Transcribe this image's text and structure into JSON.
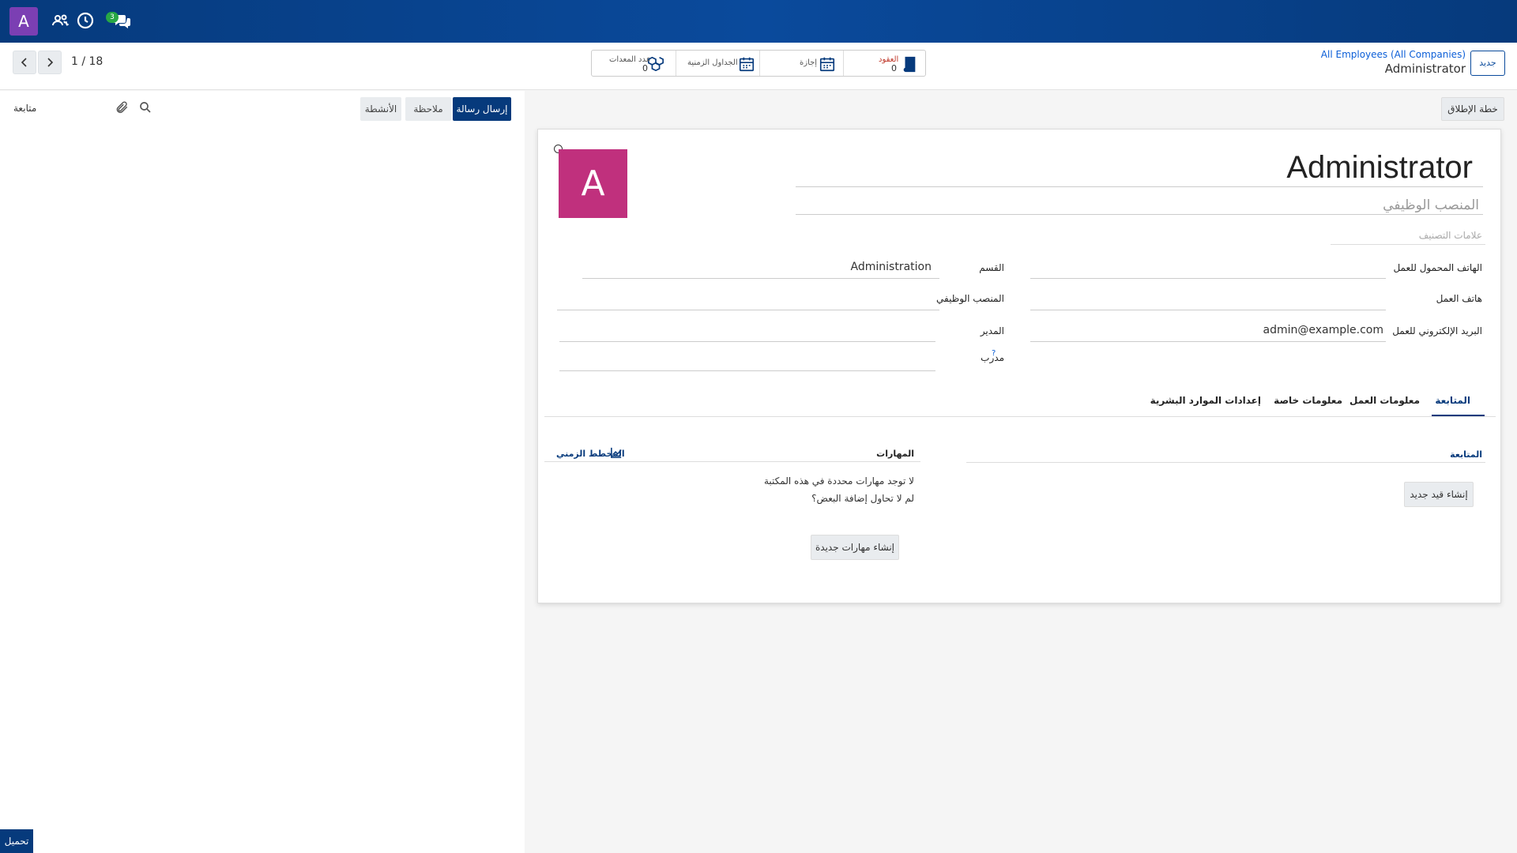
{
  "navbar": {
    "avatar_letter": "A",
    "chat_badge": "3",
    "icons": [
      "people-settings-icon",
      "clock-icon",
      "chat-icon"
    ]
  },
  "control_panel": {
    "pager": "1 / 18",
    "breadcrumb": {
      "parent": "All Employees (All Companies)",
      "current": "Administrator"
    },
    "new_button": "جديد",
    "smart_buttons": [
      {
        "label": "العقود",
        "value": "0",
        "icon": "book-icon"
      },
      {
        "label": "إجازة",
        "value": "",
        "icon": "calendar-icon"
      },
      {
        "label": "الجداول الزمنية",
        "value": "",
        "icon": "calendar-icon"
      },
      {
        "label": "عدد المعدات",
        "value": "0",
        "icon": "cubes-icon"
      }
    ]
  },
  "chatter": {
    "follow": "متابعة",
    "buttons": {
      "send_message": "إرسال رسالة",
      "log_note": "ملاحظة",
      "activities": "الأنشطة"
    },
    "load_button": "تحميل"
  },
  "form": {
    "launch_plan": "خطة الإطلاق",
    "avatar_letter": "A",
    "employee_name": "Administrator",
    "job_title_placeholder": "المنصب الوظيفي",
    "tags_placeholder": "علامات التصنيف",
    "right_fields": [
      {
        "label": "الهاتف المحمول للعمل",
        "value": ""
      },
      {
        "label": "هاتف العمل",
        "value": ""
      },
      {
        "label": "البريد الإلكتروني للعمل",
        "value": "admin@example.com"
      }
    ],
    "left_fields": [
      {
        "label": "القسم",
        "value": "Administration"
      },
      {
        "label": "المنصب الوظيفي",
        "value": ""
      },
      {
        "label": "المدير",
        "value": ""
      },
      {
        "label": "مدرب",
        "value": "",
        "help": "?"
      }
    ],
    "tabs": [
      "المتابعة",
      "معلومات العمل",
      "معلومات خاصة",
      "إعدادات الموارد البشرية"
    ],
    "resume": {
      "title": "المتابعة",
      "create_button": "إنشاء قيد جديد"
    },
    "skills": {
      "title": "المهارات",
      "chart_label": "المخطط الزمني",
      "empty_line1": "لا توجد مهارات محددة في هذه المكتبة",
      "empty_line2": "لم لا تحاول إضافة البعض؟",
      "create_button": "إنشاء مهارات جديدة"
    }
  }
}
